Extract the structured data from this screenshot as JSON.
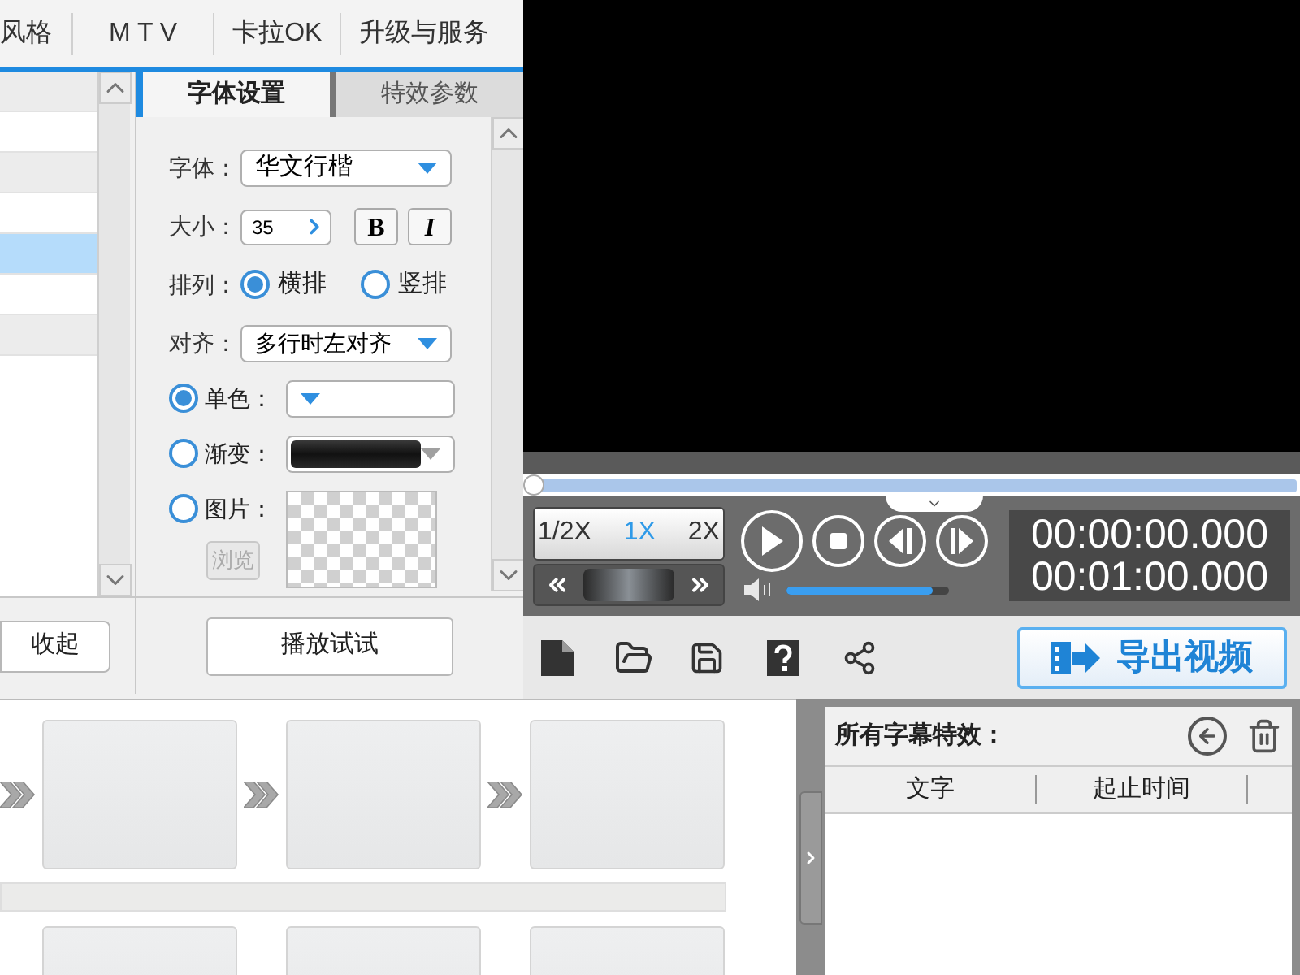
{
  "menu": [
    "风格",
    "M T V",
    "卡拉OK",
    "升级与服务"
  ],
  "list_rows": [
    {
      "selected": false
    },
    {
      "selected": false
    },
    {
      "selected": false
    },
    {
      "selected": false
    },
    {
      "selected": true
    },
    {
      "selected": false
    },
    {
      "selected": false
    }
  ],
  "collapse_button": "收起",
  "tabs": [
    {
      "label": "字体设置",
      "selected": true
    },
    {
      "label": "特效参数",
      "selected": false
    }
  ],
  "font": {
    "label": "字体：",
    "value": "华文行楷"
  },
  "size": {
    "label": "大小：",
    "value": "35",
    "bold": "B",
    "italic": "I"
  },
  "arrangement": {
    "label": "排列：",
    "options": [
      {
        "label": "横排",
        "selected": true
      },
      {
        "label": "竖排",
        "selected": false
      }
    ]
  },
  "align": {
    "label": "对齐：",
    "value": "多行时左对齐"
  },
  "fill_options": [
    {
      "kind": "solid",
      "label": "单色：",
      "selected": true
    },
    {
      "kind": "gradient",
      "label": "渐变：",
      "selected": false
    },
    {
      "kind": "image",
      "label": "图片：",
      "selected": false,
      "browse": {
        "label": "浏览",
        "disabled": true
      }
    }
  ],
  "preview_button": "播放试试",
  "player": {
    "progress": {
      "level": 0
    },
    "speeds": [
      {
        "label": "1/2X",
        "selected": false
      },
      {
        "label": "1X",
        "selected": true
      },
      {
        "label": "2X",
        "selected": false
      }
    ],
    "volume": {
      "level": 0.9
    },
    "times": [
      "00:00:00.000",
      "00:01:00.000"
    ]
  },
  "export_button": "导出视频",
  "subtitle_panel": {
    "title": "所有字幕特效：",
    "columns": [
      "文字",
      "起止时间"
    ]
  }
}
